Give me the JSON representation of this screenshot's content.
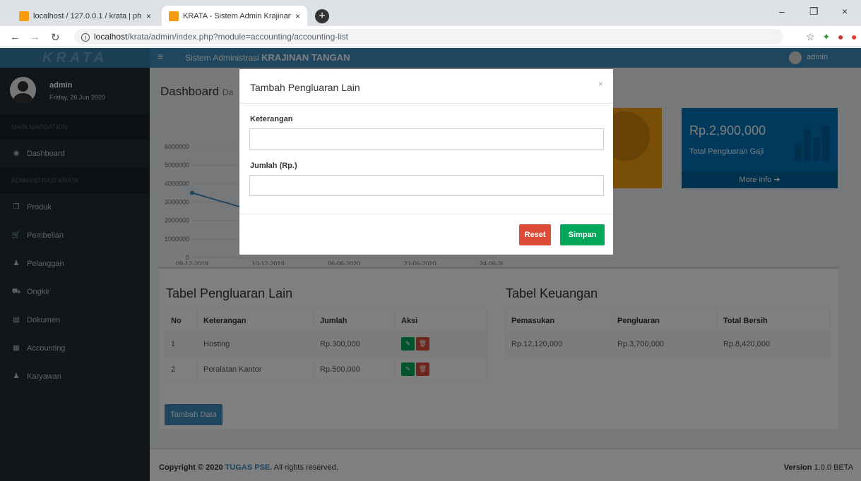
{
  "browser": {
    "tabs": [
      {
        "label": "localhost / 127.0.0.1 / krata | php",
        "close": "×"
      },
      {
        "label": "KRATA - Sistem Admin Krajinan T",
        "close": "×"
      }
    ],
    "new_tab": "+",
    "url_host": "localhost",
    "url_path": "/krata/admin/index.php?module=accounting/accounting-list",
    "window_controls": [
      "–",
      "❐",
      "×"
    ]
  },
  "app": {
    "logo": "KRATA",
    "header_prefix": "Sistem Administrasi ",
    "header_bold": "KRAJINAN TANGAN",
    "header_user": "admin"
  },
  "sidebar": {
    "user_name": "admin",
    "user_date": "Friday, 26 Jun 2020",
    "section1": "MAIN NAVIGATION",
    "dashboard": "Dashboard",
    "section2": "ADMINISTRASI KRATA",
    "items": [
      {
        "label": "Produk",
        "icon": "cube-icon",
        "glyph": "❒"
      },
      {
        "label": "Pembelian",
        "icon": "cart-icon",
        "glyph": "🛒"
      },
      {
        "label": "Pelanggan",
        "icon": "user-icon",
        "glyph": "♟"
      },
      {
        "label": "Ongkir",
        "icon": "truck-icon",
        "glyph": "⛟"
      },
      {
        "label": "Dokumen",
        "icon": "book-icon",
        "glyph": "▤"
      },
      {
        "label": "Accounting",
        "icon": "calculator-icon",
        "glyph": "▦"
      },
      {
        "label": "Karyawan",
        "icon": "user-icon",
        "glyph": "♟"
      }
    ]
  },
  "dashboard": {
    "title": "Dashboard",
    "subtitle": "Da",
    "box_value": "Rp.2,900,000",
    "box_label": "Total Pengluaran Gaji",
    "box_more": "More info ➔"
  },
  "chart_data": {
    "type": "line",
    "x": [
      "09-12-2019",
      "10-12-2019",
      "06-06-2020",
      "23-06-2020",
      "24-06-2020"
    ],
    "y_ticks": [
      "6000000",
      "5000000",
      "4000000",
      "3000000",
      "2000000",
      "1000000",
      "0"
    ],
    "ylim": [
      0,
      6000000
    ],
    "series": [
      {
        "values": [
          3500000,
          2300000
        ]
      }
    ],
    "color": "#3c8dbc"
  },
  "tables": {
    "left_title": "Tabel Pengluaran Lain",
    "left_headers": [
      "No",
      "Keterangan",
      "Jumlah",
      "Aksi"
    ],
    "left_rows": [
      [
        "1",
        "Hosting",
        "Rp.300,000"
      ],
      [
        "2",
        "Peralatan Kantor",
        "Rp.500,000"
      ]
    ],
    "right_title": "Tabel Keuangan",
    "right_headers": [
      "Pemasukan",
      "Pengluaran",
      "Total Bersih"
    ],
    "right_row": [
      "Rp.12,120,000",
      "Rp.3,700,000",
      "Rp.8,420,000"
    ],
    "add_button": "Tambah Data",
    "edit_glyph": "✎",
    "delete_glyph": "🗑"
  },
  "footer": {
    "copy_prefix": "Copyright © 2020 ",
    "copy_brand": "TUGAS PSE.",
    "copy_suffix": " All rights reserved.",
    "version_label": "Version",
    "version_value": "1.0.0 BETA"
  },
  "modal": {
    "title": "Tambah Pengluaran Lain",
    "close": "×",
    "label1": "Keterangan",
    "value1": "",
    "label2": "Jumlah (Rp.)",
    "value2": "",
    "reset": "Reset",
    "save": "Simpan"
  }
}
